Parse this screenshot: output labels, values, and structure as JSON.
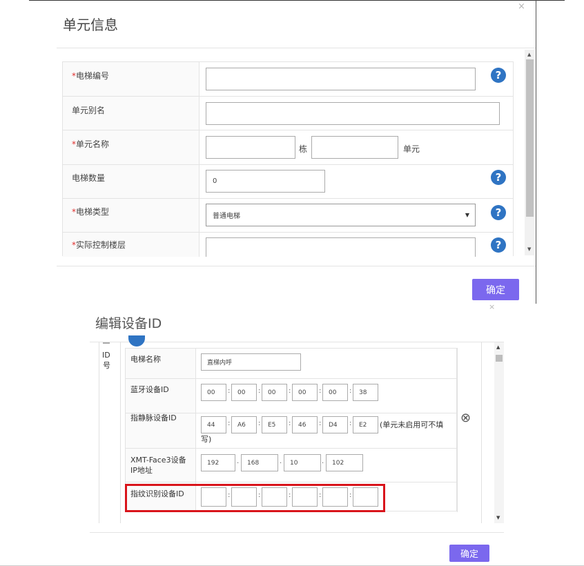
{
  "dialog1": {
    "title": "单元信息",
    "close": "×",
    "rows": [
      {
        "label": "电梯编号",
        "required": true,
        "value": ""
      },
      {
        "label": "单元别名",
        "required": false,
        "value": ""
      },
      {
        "label": "单元名称",
        "required": true,
        "building_suffix": "栋",
        "unit_suffix": "单元"
      },
      {
        "label": "电梯数量",
        "required": false,
        "value": "0"
      },
      {
        "label": "电梯类型",
        "required": true,
        "value": "普通电梯"
      },
      {
        "label": "实际控制楼层",
        "required": true,
        "value": ""
      }
    ],
    "required_mark": "*",
    "help_glyph": "?",
    "confirm": "确定"
  },
  "dialog2": {
    "title": "编辑设备ID",
    "close": "×",
    "side_label": [
      "ID",
      "号"
    ],
    "rows": [
      {
        "label": "电梯名称",
        "value": "直梯内呼"
      },
      {
        "label": "蓝牙设备ID",
        "segments": [
          "00",
          "00",
          "00",
          "00",
          "00",
          "38"
        ]
      },
      {
        "label": "指静脉设备ID",
        "segments": [
          "44",
          "A6",
          "E5",
          "46",
          "D4",
          "E2"
        ],
        "note_line1": "(单元未启用可不填",
        "note_line2": "写)"
      },
      {
        "label_line1": "XMT-Face3设备",
        "label_line2": "IP地址",
        "segments": [
          "192",
          "168",
          "10",
          "102"
        ]
      },
      {
        "label": "指纹识别设备ID",
        "segments": [
          "",
          "",
          "",
          "",
          "",
          ""
        ]
      }
    ],
    "separator_colon": ":",
    "separator_dot": ".",
    "remove_glyph": "⊗",
    "confirm": "确定"
  }
}
